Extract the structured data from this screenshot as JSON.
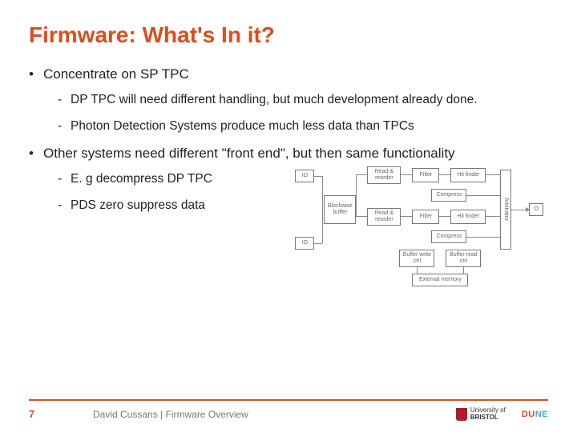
{
  "title": "Firmware: What's In it?",
  "bullets": {
    "b1": "Concentrate on SP TPC",
    "b1_1": "DP TPC will need different handling, but much development already done.",
    "b1_2": "Photon Detection Systems produce much less data than TPCs",
    "b2": "Other systems need different \"front end\", but then same functionality",
    "b2_1": "E. g decompress DP TPC",
    "b2_2": "PDS zero suppress data"
  },
  "diagram": {
    "io_top": "IO",
    "io_bottom": "IO",
    "blockwise_buffer": "Blockwise buffer",
    "read_reorder_1": "Read & reorder",
    "read_reorder_2": "Read & reorder",
    "filter_1": "Filter",
    "filter_2": "Filter",
    "hit_finder_1": "Hit finder",
    "hit_finder_2": "Hit finder",
    "compress_1": "Compress",
    "compress_2": "Compress",
    "buffer_write_ctrl": "Buffer write ctrl",
    "buffer_read_ctrl": "Buffer read ctrl",
    "arbitrator": "Arbitrator",
    "external_memory": "External memory",
    "o": "O"
  },
  "footer": {
    "page": "7",
    "text": "David Cussans | Firmware Overview",
    "bristol_line1": "University of",
    "bristol_line2": "BRISTOL",
    "dune_du": "DU",
    "dune_ne": "NE"
  }
}
